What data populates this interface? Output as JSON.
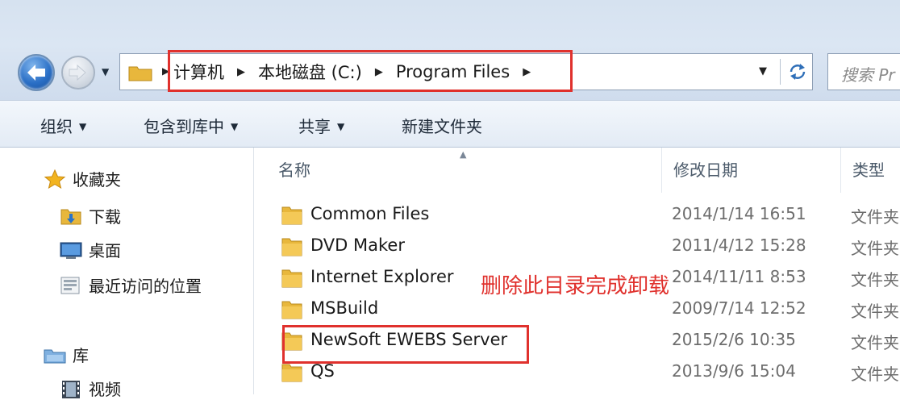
{
  "address_bar": {
    "crumbs": [
      "计算机",
      "本地磁盘 (C:)",
      "Program Files"
    ],
    "search_placeholder": "搜索 Pr"
  },
  "command_bar": {
    "organize": "组织",
    "include_in_library": "包含到库中",
    "share": "共享",
    "new_folder": "新建文件夹"
  },
  "nav_pane": {
    "favorites": "收藏夹",
    "downloads": "下载",
    "desktop": "桌面",
    "recent": "最近访问的位置",
    "libraries": "库",
    "videos": "视频"
  },
  "columns": {
    "name": "名称",
    "date_modified": "修改日期",
    "type": "类型"
  },
  "files": [
    {
      "name": "Common Files",
      "date": "2014/1/14 16:51",
      "type": "文件夹"
    },
    {
      "name": "DVD Maker",
      "date": "2011/4/12 15:28",
      "type": "文件夹"
    },
    {
      "name": "Internet Explorer",
      "date": "2014/11/11 8:53",
      "type": "文件夹"
    },
    {
      "name": "MSBuild",
      "date": "2009/7/14 12:52",
      "type": "文件夹"
    },
    {
      "name": "NewSoft EWEBS Server",
      "date": "2015/2/6 10:35",
      "type": "文件夹"
    },
    {
      "name": "QS",
      "date": "2013/9/6 15:04",
      "type": "文件夹"
    }
  ],
  "annotation": "删除此目录完成卸载",
  "colors": {
    "highlight": "#e0312d",
    "folder": "#e8b73c"
  }
}
